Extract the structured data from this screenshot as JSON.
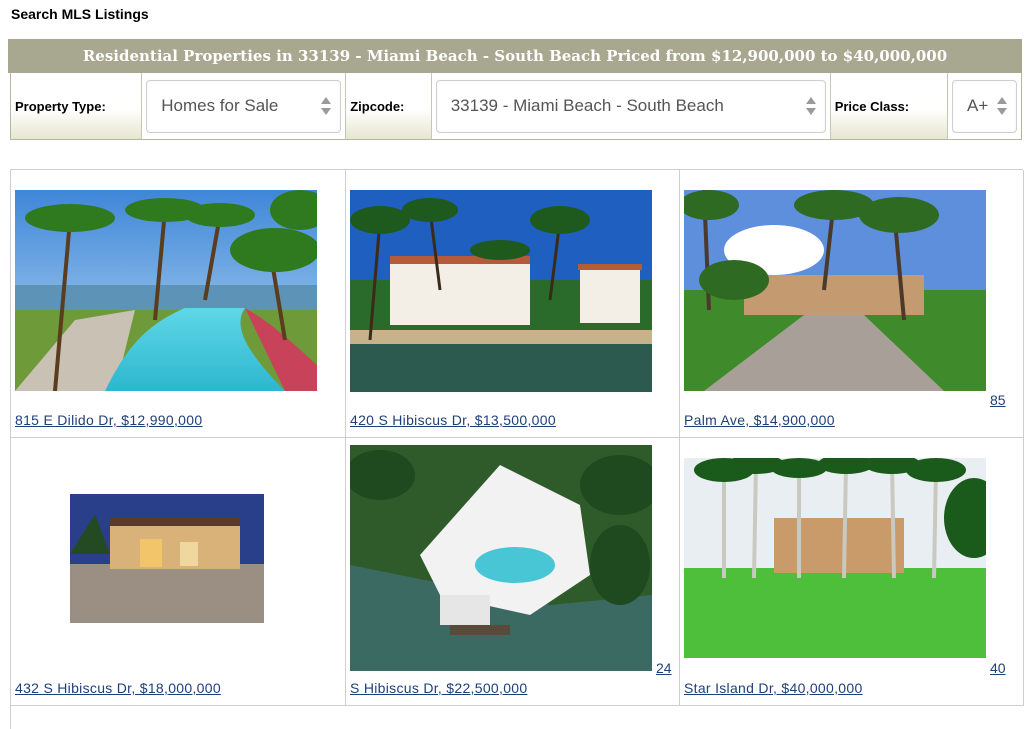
{
  "page": {
    "title": "Search MLS Listings"
  },
  "banner": {
    "text": "Residential Properties in 33139 - Miami Beach - South Beach Priced from $12,900,000 to $40,000,000"
  },
  "filters": {
    "property_type": {
      "label": "Property Type:",
      "value": "Homes for Sale"
    },
    "zipcode": {
      "label": "Zipcode:",
      "value": "33139 - Miami Beach - South Beach"
    },
    "price_class": {
      "label": "Price Class:",
      "value": "A+"
    }
  },
  "listings": [
    {
      "caption": "815 E Dilido Dr, $12,990,000",
      "photo_count": ""
    },
    {
      "caption": "420 S Hibiscus Dr, $13,500,000",
      "photo_count": ""
    },
    {
      "caption": "Palm Ave, $14,900,000",
      "photo_count": "85"
    },
    {
      "caption": "432 S Hibiscus Dr, $18,000,000",
      "photo_count": ""
    },
    {
      "caption": "S Hibiscus Dr, $22,500,000",
      "photo_count": "24"
    },
    {
      "caption": "Star Island Dr, $40,000,000",
      "photo_count": "40"
    }
  ]
}
